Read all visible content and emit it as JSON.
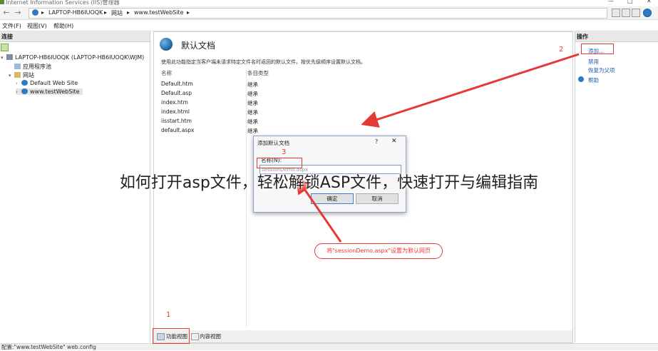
{
  "window": {
    "title": "Internet Information Services (IIS)管理器",
    "controls": {
      "minimize": "—",
      "maximize": "□",
      "close": "✕"
    }
  },
  "address": {
    "crumbs": [
      "LAPTOP-HB6IUOQK",
      "网站",
      "www.testWebSite"
    ],
    "separator": "▸"
  },
  "menu": [
    "文件(F)",
    "视图(V)",
    "帮助(H)"
  ],
  "left_pane": {
    "header": "连接",
    "tree": [
      {
        "label": "LAPTOP-HB6IUOQK (LAPTOP-HB6IUOQK\\WJM)",
        "icon": "server-icon",
        "expander": "▾"
      },
      {
        "label": "应用程序池",
        "icon": "app-pool-icon",
        "expander": ""
      },
      {
        "label": "网站",
        "icon": "sites-folder-icon",
        "expander": "▾"
      },
      {
        "label": "Default Web Site",
        "icon": "globe-icon",
        "expander": "›"
      },
      {
        "label": "www.testWebSite",
        "icon": "globe-icon",
        "expander": "›"
      }
    ]
  },
  "center": {
    "title": "默认文档",
    "description": "使用此功能指定当客户端未请求特定文件名时返回的默认文件。按优先级顺序设置默认文档。",
    "columns": [
      "名称",
      "条目类型"
    ],
    "rows": [
      {
        "name": "Default.htm",
        "type": "继承"
      },
      {
        "name": "Default.asp",
        "type": "继承"
      },
      {
        "name": "index.htm",
        "type": "继承"
      },
      {
        "name": "index.html",
        "type": "继承"
      },
      {
        "name": "iisstart.htm",
        "type": "继承"
      },
      {
        "name": "default.aspx",
        "type": "继承"
      }
    ],
    "view_tabs": [
      "功能视图",
      "内容视图"
    ]
  },
  "right_pane": {
    "header": "操作",
    "actions": [
      "添加...",
      "禁用",
      "恢复为父项",
      "帮助"
    ]
  },
  "dialog": {
    "title": "添加默认文档",
    "help": "?",
    "close": "✕",
    "field_label": "名称(N):",
    "field_value": "sessionDemo.aspx",
    "ok": "确定",
    "cancel": "取消"
  },
  "annotations": {
    "step1": "1",
    "step2": "2",
    "step3": "3",
    "callout": "将\"sessionDemo.aspx\"设置为默认网页",
    "color": "#e53935"
  },
  "overlay_text": "如何打开asp文件，轻松解锁ASP文件，快速打开与编辑指南",
  "status": "配置:\"www.testWebSite\" web.config"
}
